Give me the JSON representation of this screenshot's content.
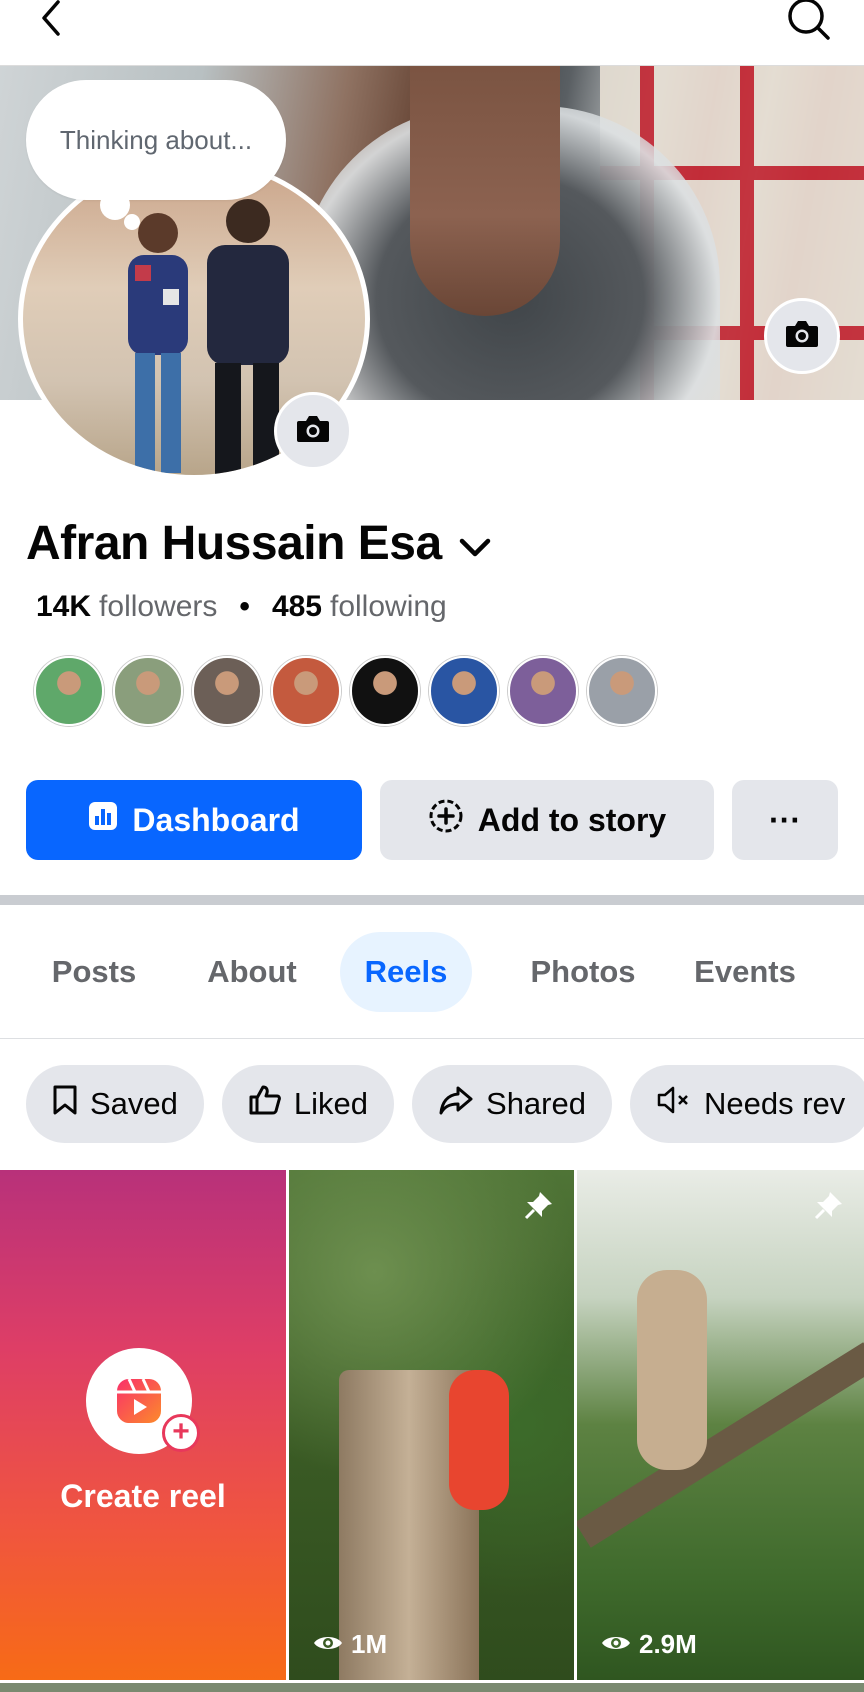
{
  "thought_bubble": {
    "text": "Thinking about..."
  },
  "profile": {
    "name": "Afran Hussain Esa",
    "followers_count": "14K",
    "followers_label": "followers",
    "separator": "•",
    "following_count": "485",
    "following_label": "following"
  },
  "friend_avatars": [
    "#5fa86a",
    "#8a9e7c",
    "#6c5f57",
    "#c45a3e",
    "#111111",
    "#2955a3",
    "#7d5f9a",
    "#9aa0a8"
  ],
  "actions": {
    "dashboard_label": "Dashboard",
    "add_story_label": "Add to story",
    "more_label": "···"
  },
  "tabs": [
    {
      "label": "Posts",
      "active": false
    },
    {
      "label": "About",
      "active": false
    },
    {
      "label": "Reels",
      "active": true
    },
    {
      "label": "Photos",
      "active": false
    },
    {
      "label": "Events",
      "active": false
    }
  ],
  "filters": [
    {
      "label": "Saved",
      "icon": "bookmark-icon"
    },
    {
      "label": "Liked",
      "icon": "thumbs-up-icon"
    },
    {
      "label": "Shared",
      "icon": "share-icon"
    },
    {
      "label": "Needs rev",
      "icon": "muted-speaker-icon"
    }
  ],
  "reels": {
    "create_label": "Create reel",
    "items": [
      {
        "views": "1M",
        "pinned": true
      },
      {
        "views": "2.9M",
        "pinned": true
      }
    ]
  },
  "colors": {
    "primary": "#0866ff",
    "secondary_bg": "#e4e6eb",
    "muted_text": "#65676b",
    "active_tab_bg": "#e7f3ff"
  }
}
